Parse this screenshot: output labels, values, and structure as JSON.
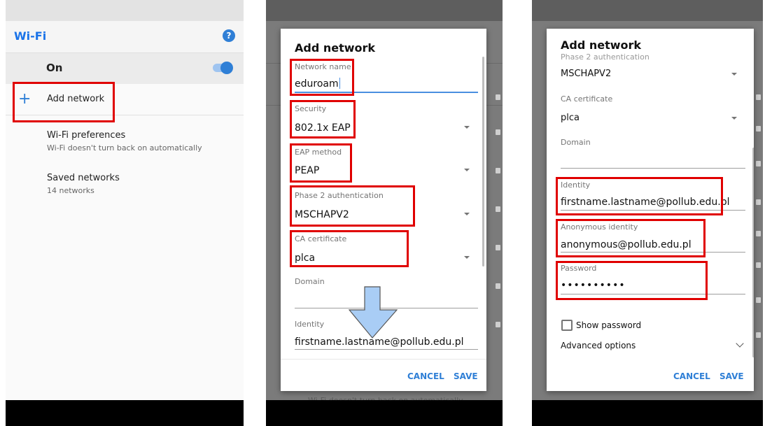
{
  "panel1": {
    "title": "Wi-Fi",
    "help_icon": "question-icon",
    "toggle_label": "On",
    "add_network": "Add network",
    "wifi_preferences": {
      "title": "Wi-Fi preferences",
      "subtitle": "Wi-Fi doesn't turn back on automatically"
    },
    "saved_networks": {
      "title": "Saved networks",
      "subtitle": "14 networks"
    }
  },
  "panel2": {
    "dialog_title": "Add network",
    "network_name": {
      "label": "Network name",
      "value": "eduroam"
    },
    "security": {
      "label": "Security",
      "value": "802.1x EAP"
    },
    "eap_method": {
      "label": "EAP method",
      "value": "PEAP"
    },
    "phase2": {
      "label": "Phase 2 authentication",
      "value": "MSCHAPV2"
    },
    "ca_certificate": {
      "label": "CA certificate",
      "value": "plca"
    },
    "domain": {
      "label": "Domain",
      "value": ""
    },
    "identity": {
      "label": "Identity",
      "value": "firstname.lastname@pollub.edu.pl"
    },
    "cancel": "CANCEL",
    "save": "SAVE",
    "background_text": "Wi-Fi doesn't turn back on automatically"
  },
  "panel3": {
    "dialog_title": "Add network",
    "phase2_label_partial": "Phase 2 authentication",
    "phase2_value": "MSCHAPV2",
    "ca_certificate": {
      "label": "CA certificate",
      "value": "plca"
    },
    "domain": {
      "label": "Domain",
      "value": ""
    },
    "identity": {
      "label": "Identity",
      "value": "firstname.lastname@pollub.edu.pl"
    },
    "anonymous_identity": {
      "label": "Anonymous identity",
      "value": "anonymous@pollub.edu.pl"
    },
    "password": {
      "label": "Password",
      "value": "••••••••••"
    },
    "show_password": "Show password",
    "advanced_options": "Advanced options",
    "cancel": "CANCEL",
    "save": "SAVE"
  },
  "colors": {
    "accent": "#2f7fd6",
    "highlight": "#e00000",
    "arrow": "#a9cdf5"
  }
}
